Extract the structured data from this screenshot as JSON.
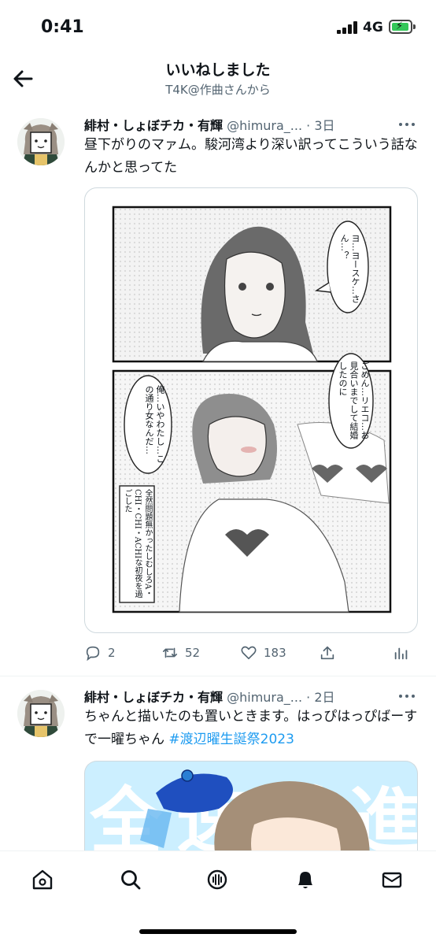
{
  "status_bar": {
    "time": "0:41",
    "network": "4G"
  },
  "header": {
    "title": "いいねしました",
    "subtitle": "T4K@作曲さんから"
  },
  "tweets": [
    {
      "author": "緋村・しょぼチカ・有輝",
      "handle": "@himura_...",
      "dot": "·",
      "time": "3日",
      "text": "昼下がりのマァム。駿河湾より深い訳ってこういう話なんかと思ってた",
      "hashtag": "",
      "media": {
        "panel1_bubble": "ヨ…ヨースケ…さん…？",
        "panel2_bubble_left": "俺…いやわたし…この通り女なんだ…",
        "panel2_bubble_right": "ごめん…リエコ…お見合いまでして結婚したのに",
        "panel2_caption": "全然問題無かったしむしろA・CHI・CHI・ACHIな初夜を過ごした"
      },
      "replies": "2",
      "retweets": "52",
      "likes": "183"
    },
    {
      "author": "緋村・しょぼチカ・有輝",
      "handle": "@himura_...",
      "dot": "·",
      "time": "2日",
      "text": "ちゃんと描いたのも置いときます。はっぴはっぴばーすで一曜ちゃん ",
      "hashtag": "#渡辺曜生誕祭2023",
      "media": {
        "bg_text": "全速前進"
      }
    }
  ],
  "nav": [
    "home-icon",
    "search-icon",
    "spaces-icon",
    "notifications-icon",
    "messages-icon"
  ],
  "colors": {
    "accent": "#1d9bf0",
    "muted": "#536471",
    "battery": "#34c759"
  }
}
